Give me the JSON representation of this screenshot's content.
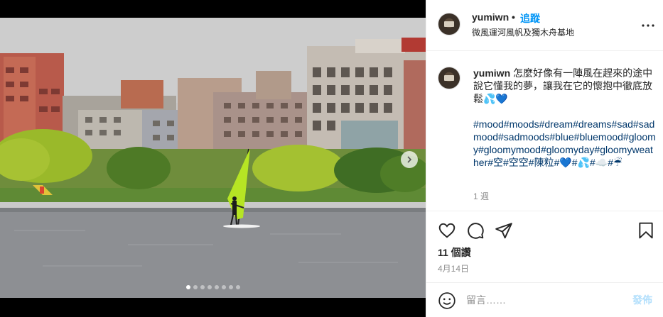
{
  "post": {
    "username": "yumiwn",
    "follow_separator": "•",
    "follow_label": "追蹤",
    "location": "微風運河風帆及獨木舟基地",
    "more_icon": "more-horizontal-icon"
  },
  "caption": {
    "username": "yumiwn",
    "text": "怎麼好像有一陣風在趕來的途中說它懂我的夢，讓我在它的懷抱中徹底放鬆💦💙",
    "hashtags": "#mood#moods#dream#dreams#sad#sadmood#sadmoods#blue#bluemood#gloomy#gloomymood#gloomyday#gloomyweather#空#空空#陳粒#💙#💦#☁️#☔",
    "time_ago": "1 週"
  },
  "actions": {
    "like_icon": "heart-icon",
    "comment_icon": "comment-icon",
    "share_icon": "share-icon",
    "save_icon": "bookmark-icon",
    "likes": "11 個讚",
    "date": "4月14日"
  },
  "comment_box": {
    "emoji_icon": "emoji-icon",
    "placeholder": "留言……",
    "post_label": "發佈"
  },
  "carousel": {
    "slide_count": 8,
    "active_index": 0
  },
  "colors": {
    "link": "#0095f6",
    "hashtag": "#00376b",
    "muted": "#8e8e8e",
    "post_disabled": "#b2dffc"
  }
}
